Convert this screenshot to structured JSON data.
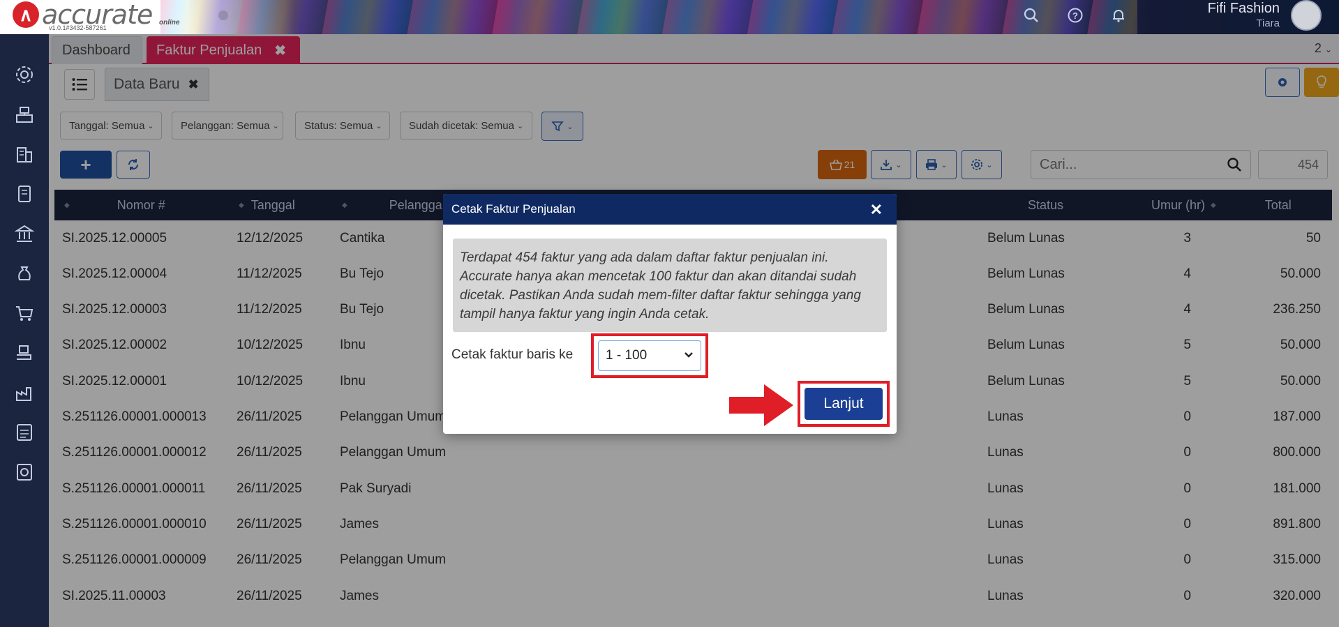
{
  "header": {
    "brand": "accurate",
    "brand_sub": "online",
    "version": "v1.0.1#3432-587261",
    "user_name": "Fifi Fashion",
    "user_role": "Tiara"
  },
  "tabs": {
    "dashboard": "Dashboard",
    "faktur": "Faktur Penjualan",
    "count": "2"
  },
  "subtab": {
    "label": "Data Baru"
  },
  "filters": {
    "tanggal": "Tanggal: Semua",
    "pelanggan": "Pelanggan: Semua",
    "status": "Status: Semua",
    "sudah_dicetak": "Sudah dicetak: Semua"
  },
  "toolbar": {
    "cart_count": "21",
    "search_placeholder": "Cari...",
    "total_count": "454"
  },
  "table": {
    "headers": {
      "nomor": "Nomor #",
      "tanggal": "Tanggal",
      "pelanggan": "Pelanggan",
      "status": "Status",
      "umur": "Umur (hr)",
      "total": "Total"
    },
    "rows": [
      {
        "nomor": "SI.2025.12.00005",
        "tanggal": "12/12/2025",
        "pelanggan": "Cantika",
        "status": "Belum Lunas",
        "umur": "3",
        "total": "50"
      },
      {
        "nomor": "SI.2025.12.00004",
        "tanggal": "11/12/2025",
        "pelanggan": "Bu Tejo",
        "status": "Belum Lunas",
        "umur": "4",
        "total": "50.000"
      },
      {
        "nomor": "SI.2025.12.00003",
        "tanggal": "11/12/2025",
        "pelanggan": "Bu Tejo",
        "status": "Belum Lunas",
        "umur": "4",
        "total": "236.250"
      },
      {
        "nomor": "SI.2025.12.00002",
        "tanggal": "10/12/2025",
        "pelanggan": "Ibnu",
        "status": "Belum Lunas",
        "umur": "5",
        "total": "50.000"
      },
      {
        "nomor": "SI.2025.12.00001",
        "tanggal": "10/12/2025",
        "pelanggan": "Ibnu",
        "status": "Belum Lunas",
        "umur": "5",
        "total": "50.000"
      },
      {
        "nomor": "S.251126.00001.000013",
        "tanggal": "26/11/2025",
        "pelanggan": "Pelanggan Umum",
        "status": "Lunas",
        "umur": "0",
        "total": "187.000"
      },
      {
        "nomor": "S.251126.00001.000012",
        "tanggal": "26/11/2025",
        "pelanggan": "Pelanggan Umum",
        "status": "Lunas",
        "umur": "0",
        "total": "800.000"
      },
      {
        "nomor": "S.251126.00001.000011",
        "tanggal": "26/11/2025",
        "pelanggan": "Pak Suryadi",
        "status": "Lunas",
        "umur": "0",
        "total": "181.000"
      },
      {
        "nomor": "S.251126.00001.000010",
        "tanggal": "26/11/2025",
        "pelanggan": "James",
        "status": "Lunas",
        "umur": "0",
        "total": "891.800"
      },
      {
        "nomor": "S.251126.00001.000009",
        "tanggal": "26/11/2025",
        "pelanggan": "Pelanggan Umum",
        "status": "Lunas",
        "umur": "0",
        "total": "315.000"
      },
      {
        "nomor": "SI.2025.11.00003",
        "tanggal": "26/11/2025",
        "pelanggan": "James",
        "status": "Lunas",
        "umur": "0",
        "total": "320.000"
      }
    ]
  },
  "modal": {
    "title": "Cetak Faktur Penjualan",
    "note": "Terdapat 454 faktur yang ada dalam daftar faktur penjualan ini. Accurate hanya akan mencetak 100 faktur dan akan ditandai sudah dicetak. Pastikan Anda sudah mem-filter daftar faktur sehingga yang tampil hanya faktur yang ingin Anda cetak.",
    "range_label": "Cetak faktur baris ke",
    "range_value": "1 - 100",
    "continue_label": "Lanjut"
  },
  "colors": {
    "nav_dark": "#1c2540",
    "accent_pink": "#e8245c",
    "primary_blue": "#1f4fa0",
    "highlight_red": "#e01e27",
    "cart_orange": "#d9660d"
  },
  "icons": [
    "search-icon",
    "help-icon",
    "bell-icon",
    "settings-icon",
    "lightbulb-icon",
    "funnel-icon",
    "refresh-icon",
    "cart-icon",
    "download-icon",
    "print-icon",
    "gear-icon",
    "close-icon",
    "chevron-down-icon",
    "arrow-right-icon"
  ]
}
